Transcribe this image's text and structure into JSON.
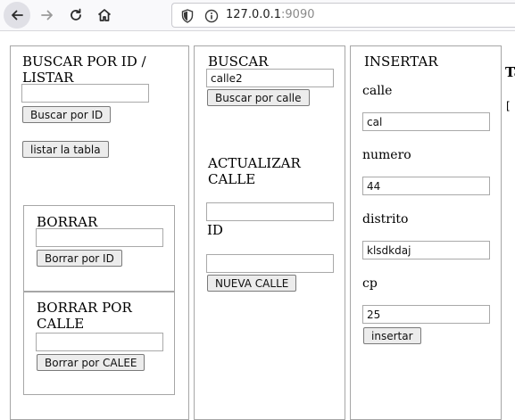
{
  "browser": {
    "url_host": "127.0.0.1",
    "url_port": ":9090"
  },
  "panel_buscar_id": {
    "heading": "BUSCAR POR ID / LISTAR",
    "id_value": "",
    "search_button": "Buscar por ID",
    "list_button": "listar la tabla"
  },
  "panel_borrar": {
    "heading": "BORRAR",
    "id_value": "",
    "button": "Borrar por ID"
  },
  "panel_borrar_calle": {
    "heading": "BORRAR POR CALLE",
    "calle_value": "",
    "button": "Borrar por CALEE"
  },
  "panel_buscar": {
    "heading": "BUSCAR",
    "calle_value": "calle2",
    "button": "Buscar por calle"
  },
  "panel_actualizar": {
    "heading": "ACTUALIZAR CALLE",
    "calle_value": "",
    "id_label": "ID",
    "id_value": "",
    "button": "NUEVA CALLE"
  },
  "panel_insertar": {
    "heading": "INSERTAR",
    "calle_label": "calle",
    "calle_value": "cal",
    "numero_label": "numero",
    "numero_value": "44",
    "distrito_label": "distrito",
    "distrito_value": "klsdkdaj",
    "cp_label": "cp",
    "cp_value": "25",
    "button": "insertar"
  },
  "cut_off": {
    "heading_fragment": "Ta",
    "bracket": "["
  }
}
